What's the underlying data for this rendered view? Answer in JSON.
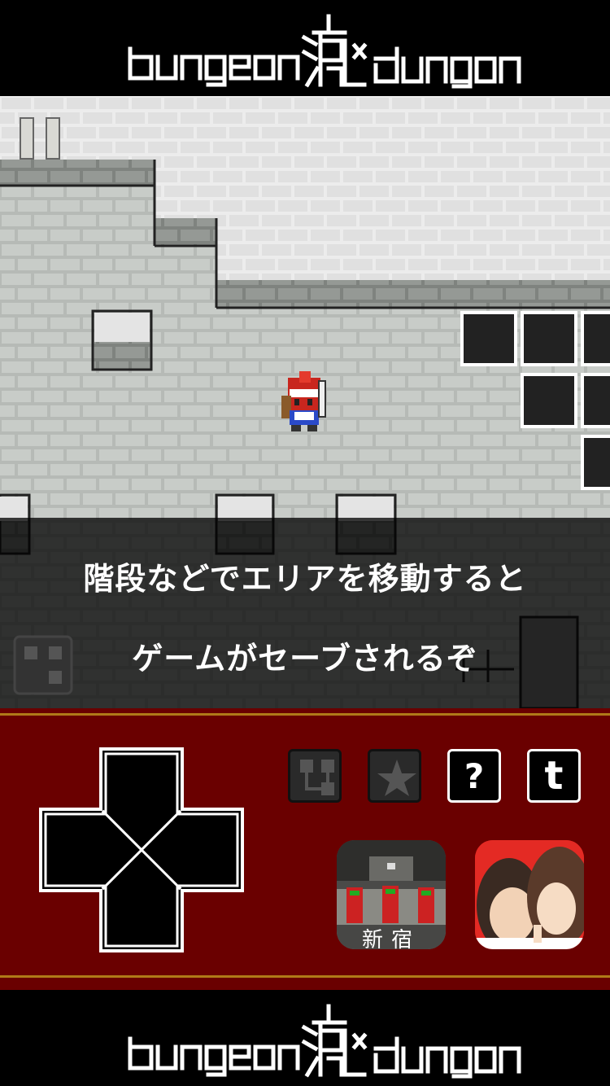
{
  "banner_top": {
    "logo_text": "dungeon 渋谷 dungeon"
  },
  "game": {
    "caption_line1": "階段などでエリアを移動すると",
    "caption_line2": "ゲームがセーブされるぞ"
  },
  "controls": {
    "map_icon": "map-icon",
    "star_icon": "star-icon",
    "help_label": "?",
    "twitter_label": "t"
  },
  "promos": [
    {
      "name": "shinjuku-station-game",
      "caption": "新宿"
    },
    {
      "name": "romance-game",
      "caption": ""
    }
  ],
  "banner_bottom": {
    "logo_text": "dungeon 渋谷 dungeon"
  }
}
